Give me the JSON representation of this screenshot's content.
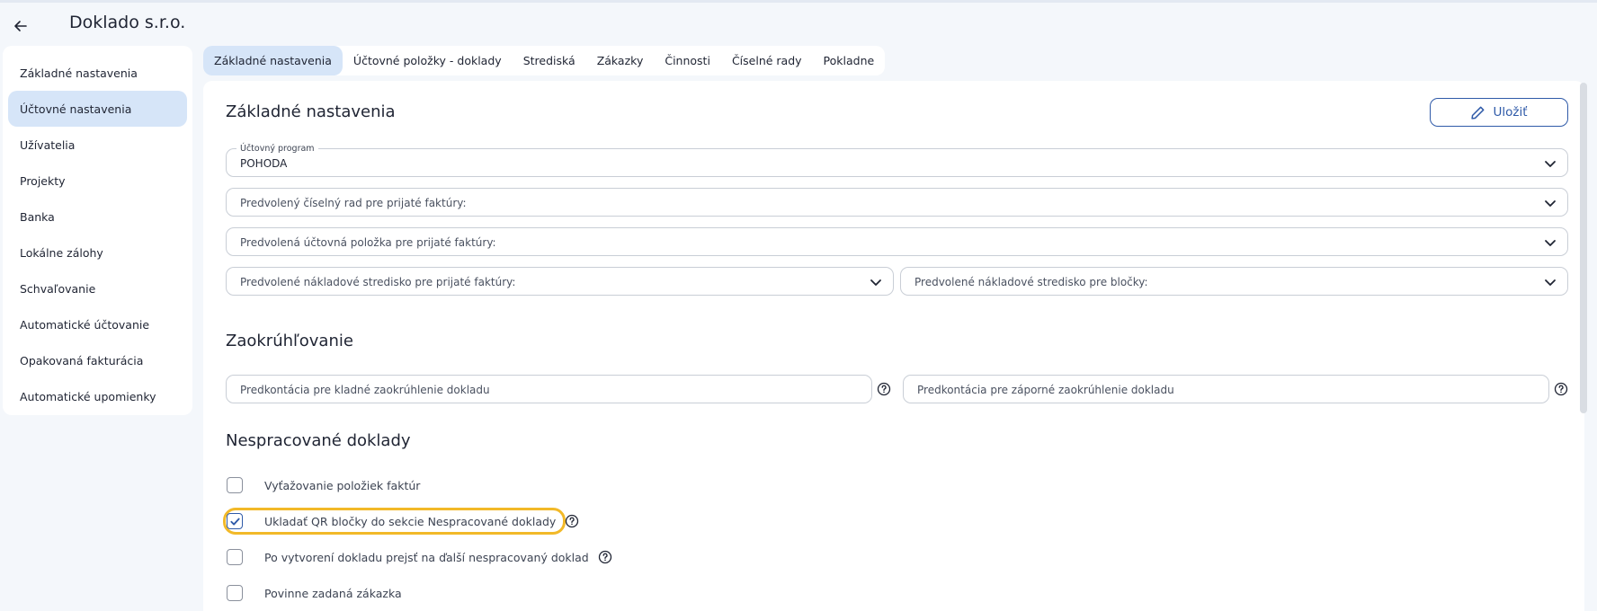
{
  "header": {
    "title": "Doklado s.r.o.",
    "back_icon": "arrow-left-icon"
  },
  "sidebar": {
    "items": [
      {
        "label": "Základné nastavenia",
        "active": false
      },
      {
        "label": "Účtovné nastavenia",
        "active": true
      },
      {
        "label": "Užívatelia",
        "active": false
      },
      {
        "label": "Projekty",
        "active": false
      },
      {
        "label": "Banka",
        "active": false
      },
      {
        "label": "Lokálne zálohy",
        "active": false
      },
      {
        "label": "Schvaľovanie",
        "active": false
      },
      {
        "label": "Automatické účtovanie",
        "active": false
      },
      {
        "label": "Opakovaná fakturácia",
        "active": false
      },
      {
        "label": "Automatické upomienky",
        "active": false
      }
    ]
  },
  "tabs": [
    {
      "label": "Základné nastavenia",
      "active": true
    },
    {
      "label": "Účtovné položky - doklady",
      "active": false
    },
    {
      "label": "Strediská",
      "active": false
    },
    {
      "label": "Zákazky",
      "active": false
    },
    {
      "label": "Činnosti",
      "active": false
    },
    {
      "label": "Číselné rady",
      "active": false
    },
    {
      "label": "Pokladne",
      "active": false
    }
  ],
  "main": {
    "basic_title": "Základné nastavenia",
    "save_label": "Uložiť",
    "accounting_program": {
      "label": "Účtovný program",
      "value": "POHODA"
    },
    "number_series_placeholder": "Predvolený číselný rad pre prijaté faktúry:",
    "accounting_item_placeholder": "Predvolená účtovná položka pre prijaté faktúry:",
    "cost_center_invoices_placeholder": "Predvolené nákladové stredisko pre prijaté faktúry:",
    "cost_center_receipts_placeholder": "Predvolené nákladové stredisko pre bločky:",
    "rounding_title": "Zaokrúhľovanie",
    "rounding_positive_placeholder": "Predkontácia pre kladné zaokrúhlenie dokladu",
    "rounding_negative_placeholder": "Predkontácia pre záporné zaokrúhlenie dokladu",
    "unprocessed_title": "Nespracované doklady",
    "checkboxes": [
      {
        "label": "Vyťažovanie položiek faktúr",
        "checked": false,
        "help": false
      },
      {
        "label": "Ukladať QR bločky do sekcie Nespracované doklady",
        "checked": true,
        "help": true
      },
      {
        "label": "Po vytvorení dokladu prejsť na ďalší nespracovaný doklad",
        "checked": false,
        "help": true
      },
      {
        "label": "Povinne zadaná zákazka",
        "checked": false,
        "help": false
      }
    ]
  },
  "colors": {
    "accent": "#2f5aa8",
    "active_bg": "#d6e5f8",
    "highlight": "#f2b928",
    "page_bg": "#f4f7fb"
  }
}
